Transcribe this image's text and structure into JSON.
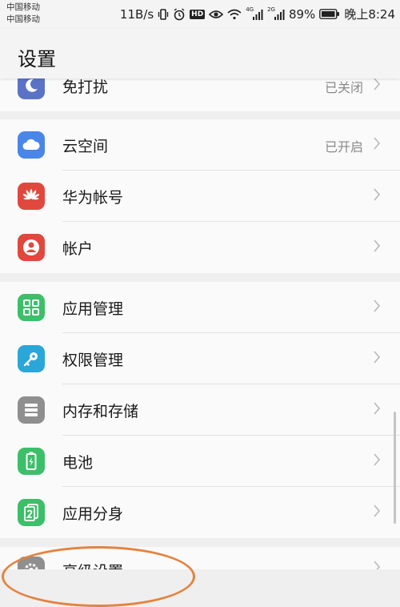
{
  "status": {
    "carrier1": "中国移动",
    "carrier2": "中国移动",
    "speed": "11B/s",
    "hd": "HD",
    "net1": "4G",
    "net2": "2G",
    "battery": "89%",
    "time": "晚上8:24"
  },
  "header": {
    "title": "设置"
  },
  "groups": [
    {
      "items": [
        {
          "label": "免打扰",
          "value": "已关闭",
          "icon": "moon-icon",
          "color": "#5b73c7"
        }
      ]
    },
    {
      "items": [
        {
          "label": "云空间",
          "value": "已开启",
          "icon": "cloud-icon",
          "color": "#4a86e8"
        },
        {
          "label": "华为帐号",
          "value": "",
          "icon": "huawei-logo-icon",
          "color": "#e0483e"
        },
        {
          "label": "帐户",
          "value": "",
          "icon": "user-icon",
          "color": "#e0483e"
        }
      ]
    },
    {
      "items": [
        {
          "label": "应用管理",
          "value": "",
          "icon": "apps-grid-icon",
          "color": "#3dbf6a"
        },
        {
          "label": "权限管理",
          "value": "",
          "icon": "key-icon",
          "color": "#2aa6d8"
        },
        {
          "label": "内存和存储",
          "value": "",
          "icon": "storage-icon",
          "color": "#8f8f8f"
        },
        {
          "label": "电池",
          "value": "",
          "icon": "battery-icon",
          "color": "#3dbf6a"
        },
        {
          "label": "应用分身",
          "value": "",
          "icon": "app-twin-icon",
          "color": "#3dbf6a"
        }
      ]
    },
    {
      "items": [
        {
          "label": "高级设置",
          "value": "",
          "icon": "gear-icon",
          "color": "#8f8f8f"
        }
      ]
    }
  ]
}
